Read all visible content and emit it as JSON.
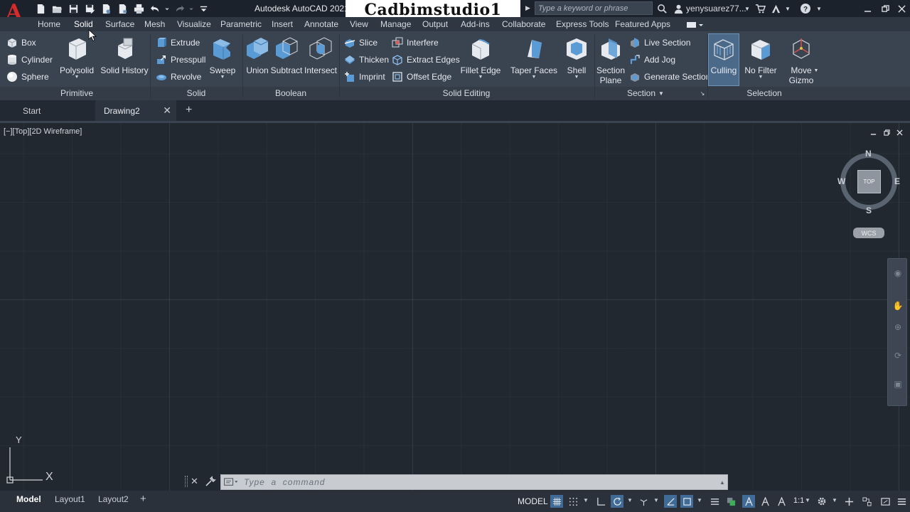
{
  "titlebar": {
    "logo": "A",
    "app_title": "Autodesk AutoCAD 2021",
    "watermark": "Cadbimstudio1",
    "search_placeholder": "Type a keyword or phrase",
    "user_name": "yenysuarez77...",
    "help_label": "?"
  },
  "ribbon_tabs": [
    "Home",
    "Solid",
    "Surface",
    "Mesh",
    "Visualize",
    "Parametric",
    "Insert",
    "Annotate",
    "View",
    "Manage",
    "Output",
    "Add-ins",
    "Collaborate",
    "Express Tools",
    "Featured Apps"
  ],
  "active_ribbon_tab": "Solid",
  "ribbon": {
    "primitive": {
      "label": "Primitive",
      "box": "Box",
      "cylinder": "Cylinder",
      "sphere": "Sphere",
      "polysolid": "Polysolid",
      "solid_history": "Solid History"
    },
    "solid": {
      "label": "Solid",
      "extrude": "Extrude",
      "presspull": "Presspull",
      "revolve": "Revolve",
      "sweep": "Sweep"
    },
    "boolean": {
      "label": "Boolean",
      "union": "Union",
      "subtract": "Subtract",
      "intersect": "Intersect"
    },
    "solid_editing": {
      "label": "Solid Editing",
      "slice": "Slice",
      "thicken": "Thicken",
      "imprint": "Imprint",
      "interfere": "Interfere",
      "extract_edges": "Extract Edges",
      "offset_edge": "Offset Edge",
      "fillet_edge": "Fillet Edge",
      "taper_faces": "Taper Faces",
      "shell": "Shell"
    },
    "section": {
      "label": "Section",
      "section_plane_1": "Section",
      "section_plane_2": "Plane",
      "live_section": "Live Section",
      "add_jog": "Add Jog",
      "generate_section": "Generate Section"
    },
    "selection": {
      "label": "Selection",
      "culling": "Culling",
      "no_filter": "No Filter",
      "move_gizmo_1": "Move",
      "move_gizmo_2": "Gizmo"
    }
  },
  "file_tabs": {
    "start": "Start",
    "drawing": "Drawing2"
  },
  "viewport": {
    "label": "[−][Top][2D Wireframe]",
    "viewcube": {
      "face": "TOP",
      "n": "N",
      "s": "S",
      "e": "E",
      "w": "W",
      "wcs": "WCS"
    },
    "ucs": {
      "x": "X",
      "y": "Y"
    }
  },
  "command_line": {
    "placeholder": "Type  a  command"
  },
  "layout_tabs": [
    "Model",
    "Layout1",
    "Layout2"
  ],
  "status": {
    "model": "MODEL",
    "scale": "1:1"
  },
  "colors": {
    "titlebar": "#1b222b",
    "ribbon": "#3a4350",
    "viewport": "#212830",
    "accent": "#3f6b96",
    "logo": "#d52b2b"
  }
}
